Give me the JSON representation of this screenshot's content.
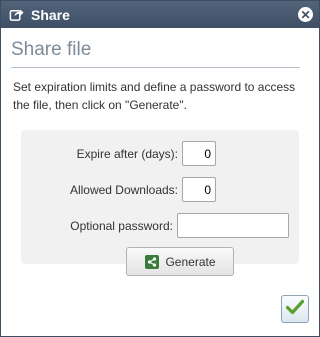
{
  "window": {
    "title": "Share",
    "close_icon": "close-icon",
    "share_icon": "share-square-icon"
  },
  "dialog": {
    "heading": "Share file",
    "description": "Set expiration limits and define a password to access the file, then click on \"Generate\"."
  },
  "form": {
    "expire_label": "Expire after (days):",
    "expire_value": "0",
    "downloads_label": "Allowed Downloads:",
    "downloads_value": "0",
    "password_label": "Optional password:",
    "password_value": "",
    "generate_label": "Generate"
  },
  "colors": {
    "titlebar": "#485a70",
    "generate_icon": "#3a7d3a",
    "ok_check": "#5aa02c"
  }
}
